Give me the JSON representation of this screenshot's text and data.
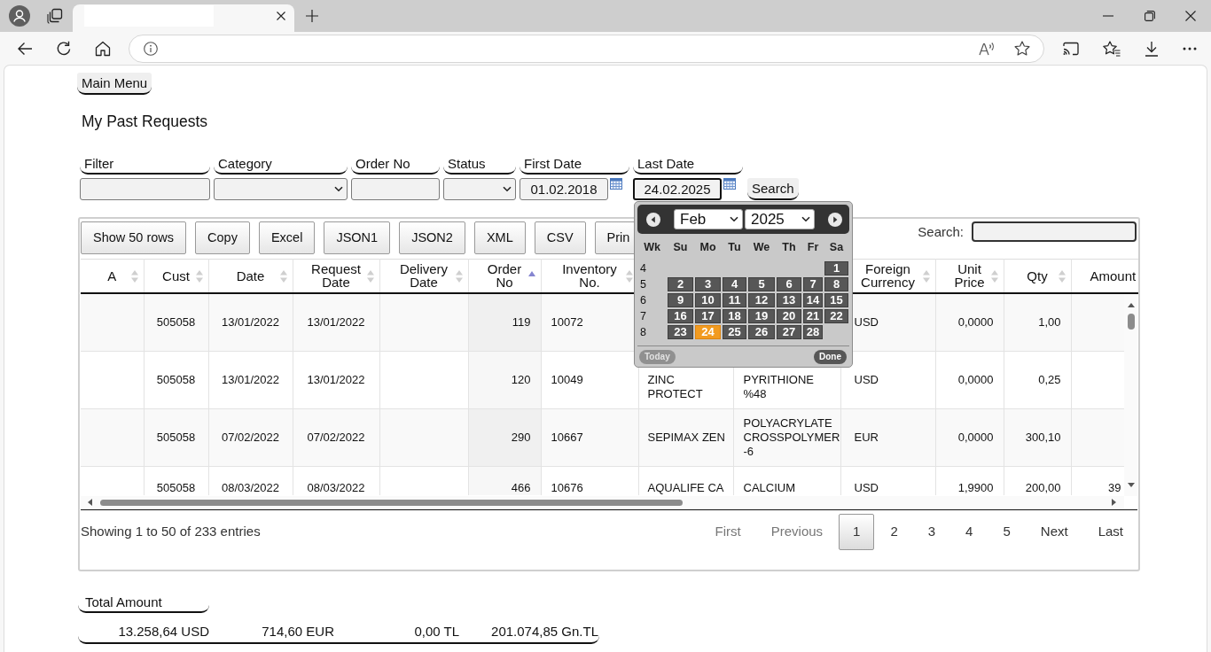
{
  "main_menu": {
    "label": "Main Menu"
  },
  "heading": "My Past Requests",
  "filters": [
    {
      "label": "Filter",
      "kind": "text",
      "focused": false
    },
    {
      "label": "Category",
      "kind": "select",
      "focused": false
    },
    {
      "label": "Order No",
      "kind": "text",
      "focused": false
    },
    {
      "label": "Status",
      "kind": "select",
      "focused": false
    },
    {
      "label": "First Date",
      "kind": "date",
      "value": "01.02.2018",
      "focused": false
    },
    {
      "label": "Last Date",
      "kind": "date",
      "value": "24.02.2025",
      "focused": true
    }
  ],
  "search_button": "Search",
  "datepicker": {
    "month": "Feb",
    "year": "2025",
    "weekdays": [
      "Wk",
      "Su",
      "Mo",
      "Tu",
      "We",
      "Th",
      "Fr",
      "Sa"
    ],
    "weeks": [
      {
        "number": "4",
        "days": [
          {
            "label": "1",
            "selected": false
          }
        ]
      },
      {
        "number": "5",
        "days": [
          {
            "label": "2",
            "selected": false
          },
          {
            "label": "3",
            "selected": false
          },
          {
            "label": "4",
            "selected": false
          },
          {
            "label": "5",
            "selected": false
          },
          {
            "label": "6",
            "selected": false
          },
          {
            "label": "7",
            "selected": false
          },
          {
            "label": "8",
            "selected": false
          }
        ]
      },
      {
        "number": "6",
        "days": [
          {
            "label": "9",
            "selected": false
          },
          {
            "label": "10",
            "selected": false
          },
          {
            "label": "11",
            "selected": false
          },
          {
            "label": "12",
            "selected": false
          },
          {
            "label": "13",
            "selected": false
          },
          {
            "label": "14",
            "selected": false
          },
          {
            "label": "15",
            "selected": false
          }
        ]
      },
      {
        "number": "7",
        "days": [
          {
            "label": "16",
            "selected": false
          },
          {
            "label": "17",
            "selected": false
          },
          {
            "label": "18",
            "selected": false
          },
          {
            "label": "19",
            "selected": false
          },
          {
            "label": "20",
            "selected": false
          },
          {
            "label": "21",
            "selected": false
          },
          {
            "label": "22",
            "selected": false
          }
        ]
      },
      {
        "number": "8",
        "days": [
          {
            "label": "23",
            "selected": false
          },
          {
            "label": "24",
            "selected": true
          },
          {
            "label": "25",
            "selected": false
          },
          {
            "label": "26",
            "selected": false
          },
          {
            "label": "27",
            "selected": false
          },
          {
            "label": "28",
            "selected": false
          }
        ]
      }
    ],
    "buttons": [
      {
        "label": "Today",
        "kind": "secondary"
      },
      {
        "label": "Done",
        "kind": "primary"
      }
    ]
  },
  "toolbar_buttons": [
    "Show 50 rows",
    "Copy",
    "Excel",
    "JSON1",
    "JSON2",
    "XML",
    "CSV",
    "Prin"
  ],
  "table_search": {
    "label": "Search:"
  },
  "table": {
    "columns": [
      {
        "label": "A",
        "sorted": false
      },
      {
        "label": "Cust",
        "sorted": false
      },
      {
        "label": "Date",
        "sorted": false
      },
      {
        "label": "Request Date",
        "sorted": false
      },
      {
        "label": "Delivery Date",
        "sorted": false
      },
      {
        "label": "Order No",
        "sorted": true
      },
      {
        "label": "Inventory No.",
        "sorted": false
      },
      {},
      {},
      {
        "label": "Foreign Currency",
        "sorted": false
      },
      {
        "label": "Unit Price",
        "sorted": false
      },
      {
        "label": "Qty",
        "sorted": false
      },
      {
        "label": "Amount"
      }
    ],
    "rows": [
      {
        "cust": "505058",
        "date": "13/01/2022",
        "request_date": "13/01/2022",
        "order_no": "119",
        "inventory_no": "10072",
        "foreign_currency": "USD",
        "unit_price": "0,0000",
        "qty": "1,00"
      },
      {
        "cust": "505058",
        "date": "13/01/2022",
        "request_date": "13/01/2022",
        "order_no": "120",
        "inventory_no": "10049",
        "column_8": "ZINC PROTECT",
        "column_9": "PYRITHIONE %48",
        "foreign_currency": "USD",
        "unit_price": "0,0000",
        "qty": "0,25"
      },
      {
        "cust": "505058",
        "date": "07/02/2022",
        "request_date": "07/02/2022",
        "order_no": "290",
        "inventory_no": "10667",
        "column_8": "SEPIMAX ZEN",
        "column_9": "POLYACRYLATE CROSSPOLYMER -6",
        "foreign_currency": "EUR",
        "unit_price": "0,0000",
        "qty": "300,10"
      },
      {
        "cust": "505058",
        "date": "08/03/2022",
        "request_date": "08/03/2022",
        "order_no": "466",
        "inventory_no": "10676",
        "column_8": "AQUALIFE CA",
        "column_9": "CALCIUM",
        "foreign_currency": "USD",
        "unit_price": "1,9900",
        "qty": "200,00",
        "amount": "39"
      }
    ]
  },
  "info": "Showing 1 to 50 of 233 entries",
  "pagination": [
    {
      "label": "First",
      "selected": false,
      "disabled": true
    },
    {
      "label": "Previous",
      "selected": false,
      "disabled": true
    },
    {
      "label": "1",
      "selected": true,
      "disabled": false
    },
    {
      "label": "2",
      "selected": false,
      "disabled": false
    },
    {
      "label": "3",
      "selected": false,
      "disabled": false
    },
    {
      "label": "4",
      "selected": false,
      "disabled": false
    },
    {
      "label": "5",
      "selected": false,
      "disabled": false
    },
    {
      "label": "Next",
      "selected": false,
      "disabled": false
    },
    {
      "label": "Last",
      "selected": false,
      "disabled": false
    }
  ],
  "totals": {
    "label": "Total Amount",
    "values": [
      "13.258,64 USD",
      "714,60 EUR",
      "0,00 TL",
      "201.074,85 Gn.TL"
    ]
  }
}
